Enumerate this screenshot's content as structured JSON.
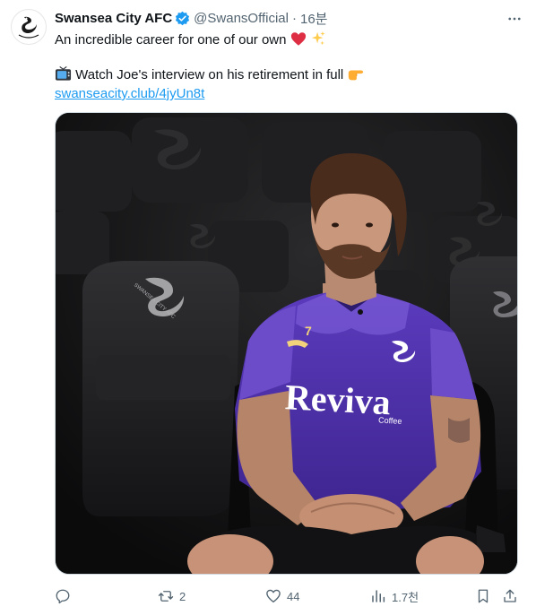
{
  "tweet": {
    "author_name": "Swansea City AFC",
    "handle": "@SwansOfficial",
    "separator": "·",
    "time": "16분",
    "line1": "An incredible career for one of our own",
    "line2": "Watch Joe's interview on his retirement in full",
    "link": "swanseacity.club/4jyUn8t",
    "colors": {
      "verified": "#1d9bf0",
      "link": "#1d9bf0",
      "muted": "#536471",
      "jersey": "#4b2fa6"
    }
  },
  "media": {
    "shirt_sponsor": "Reviva",
    "shirt_sponsor_small": "Coffee",
    "shirt_number": "7",
    "seat_text": "SWANSEA CITY AFC"
  },
  "actions": {
    "reply_count": "",
    "retweet_count": "2",
    "like_count": "44",
    "views_count": "1.7천"
  }
}
